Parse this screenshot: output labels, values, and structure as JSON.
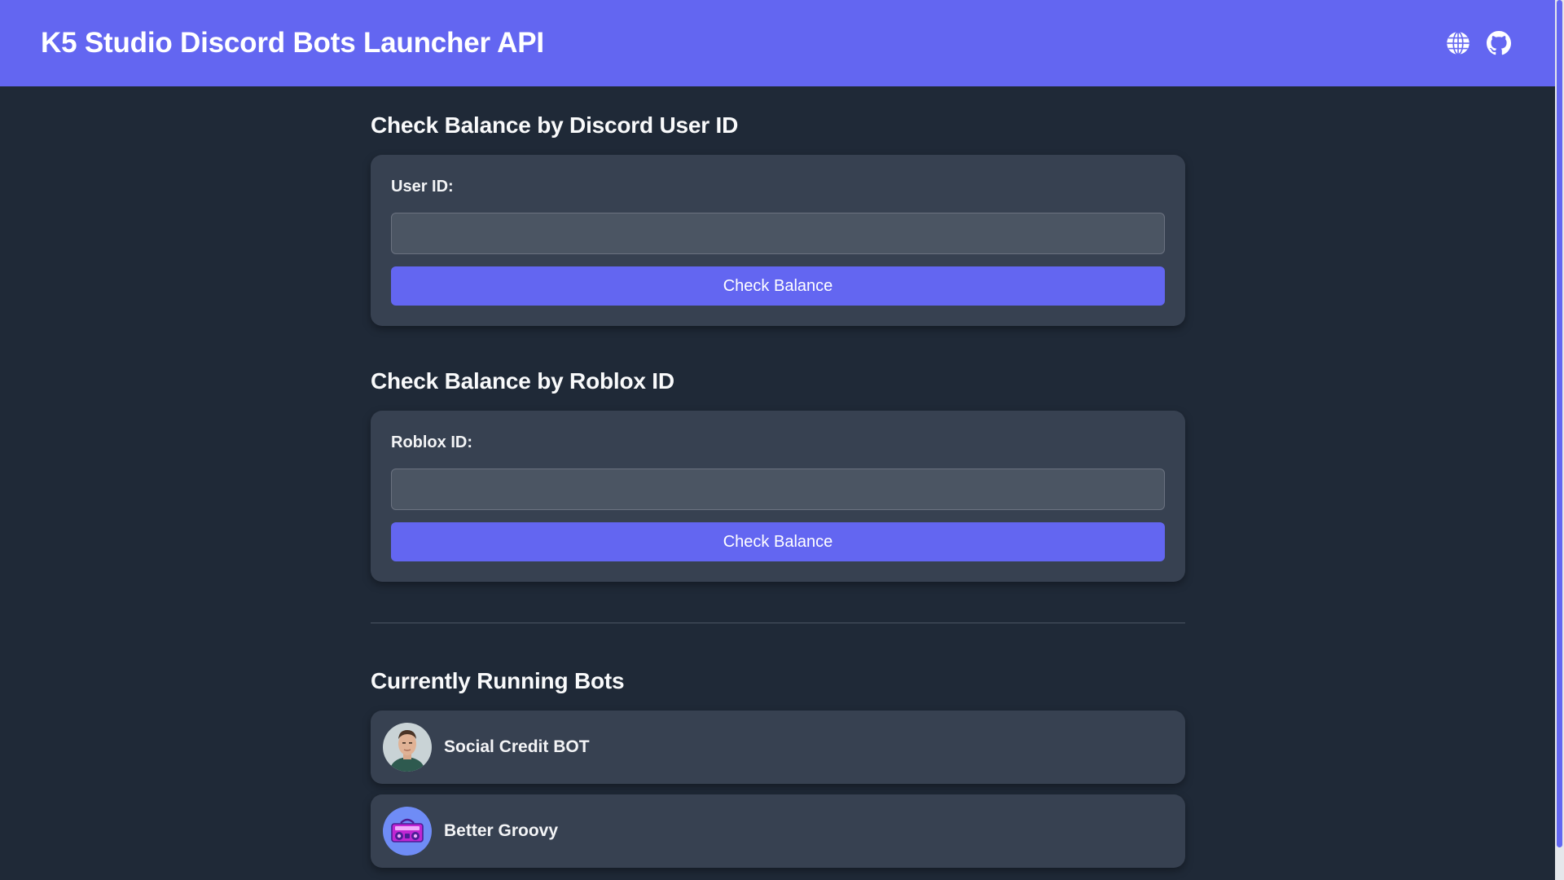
{
  "header": {
    "title": "K5 Studio Discord Bots Launcher API",
    "icons": [
      "globe-icon",
      "github-icon"
    ]
  },
  "discord_section": {
    "title": "Check Balance by Discord User ID",
    "label": "User ID:",
    "input_value": "",
    "button_label": "Check Balance"
  },
  "roblox_section": {
    "title": "Check Balance by Roblox ID",
    "label": "Roblox ID:",
    "input_value": "",
    "button_label": "Check Balance"
  },
  "bots_section": {
    "title": "Currently Running Bots",
    "bots": [
      {
        "name": "Social Credit BOT",
        "avatar": "man-portrait-avatar"
      },
      {
        "name": "Better Groovy",
        "avatar": "boombox-avatar"
      }
    ]
  },
  "colors": {
    "accent": "#6366f1",
    "background": "#1f2937",
    "card": "#374151",
    "input": "#4b5563"
  }
}
